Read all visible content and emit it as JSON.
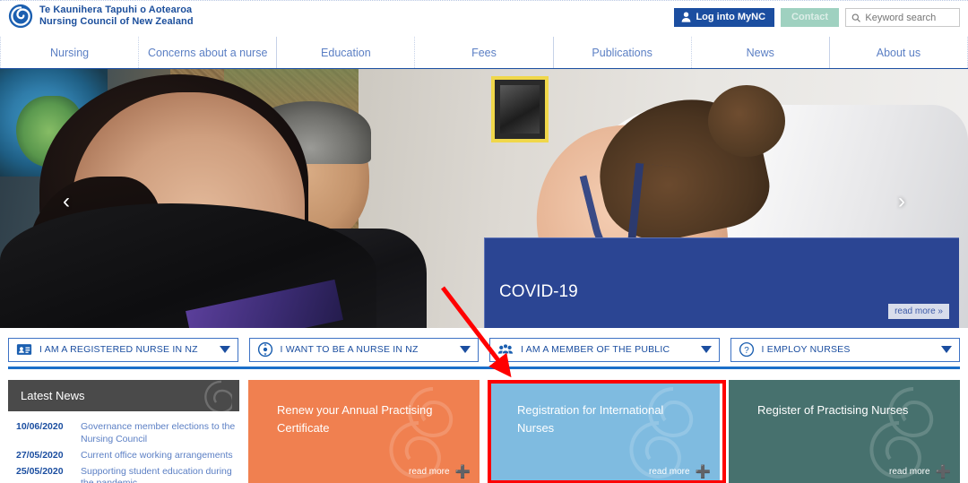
{
  "header": {
    "brand_line_1": "Te Kaunihera Tapuhi o Aotearoa",
    "brand_line_2": "Nursing Council of New Zealand",
    "logo_icon": "koru-spiral-icon",
    "login_label": "Log into MyNC",
    "login_icon": "user-icon",
    "login_bg": "#1b4ea0",
    "contact_label": "Contact",
    "contact_bg": "#9fd1c0",
    "search_placeholder": "Keyword search",
    "search_value": "",
    "search_icon": "search-icon"
  },
  "nav": {
    "items": [
      {
        "label": "Nursing"
      },
      {
        "label": "Concerns about a nurse"
      },
      {
        "label": "Education"
      },
      {
        "label": "Fees"
      },
      {
        "label": "Publications"
      },
      {
        "label": "News"
      },
      {
        "label": "About us"
      }
    ]
  },
  "hero": {
    "prev_icon": "chevron-left-icon",
    "next_icon": "chevron-right-icon",
    "prev_glyph": "‹",
    "next_glyph": "›",
    "banner": {
      "title": "COVID-19",
      "read_more_label": "read more »",
      "bg": "#2b4593"
    }
  },
  "selectors": [
    {
      "label": "I AM A REGISTERED NURSE IN NZ",
      "icon": "id-card-icon"
    },
    {
      "label": "I WANT TO BE A NURSE IN NZ",
      "icon": "arrow-circle-icon"
    },
    {
      "label": "I AM A MEMBER OF THE PUBLIC",
      "icon": "people-group-icon"
    },
    {
      "label": "I EMPLOY NURSES",
      "icon": "question-circle-icon"
    }
  ],
  "news": {
    "title": "Latest News",
    "header_bg": "#4a4a4a",
    "items": [
      {
        "date": "10/06/2020",
        "title": "Governance member elections to the Nursing Council"
      },
      {
        "date": "27/05/2020",
        "title": "Current office working arrangements"
      },
      {
        "date": "25/05/2020",
        "title": "Supporting student education during the pandemic"
      }
    ]
  },
  "tiles": [
    {
      "title": "Renew your Annual Practising Certificate",
      "read_more_label": "read more",
      "bg": "#f08050",
      "highlighted": false
    },
    {
      "title": "Registration for International Nurses",
      "read_more_label": "read more",
      "bg": "#7fbbe0",
      "highlighted": true
    },
    {
      "title": "Register of Practising Nurses",
      "read_more_label": "read more",
      "bg": "#47716e",
      "highlighted": false
    }
  ],
  "annotation": {
    "arrow_color": "#ff0000",
    "highlight_color": "#ff0000",
    "arrow_from": "495,322",
    "arrow_to": "566,414"
  }
}
